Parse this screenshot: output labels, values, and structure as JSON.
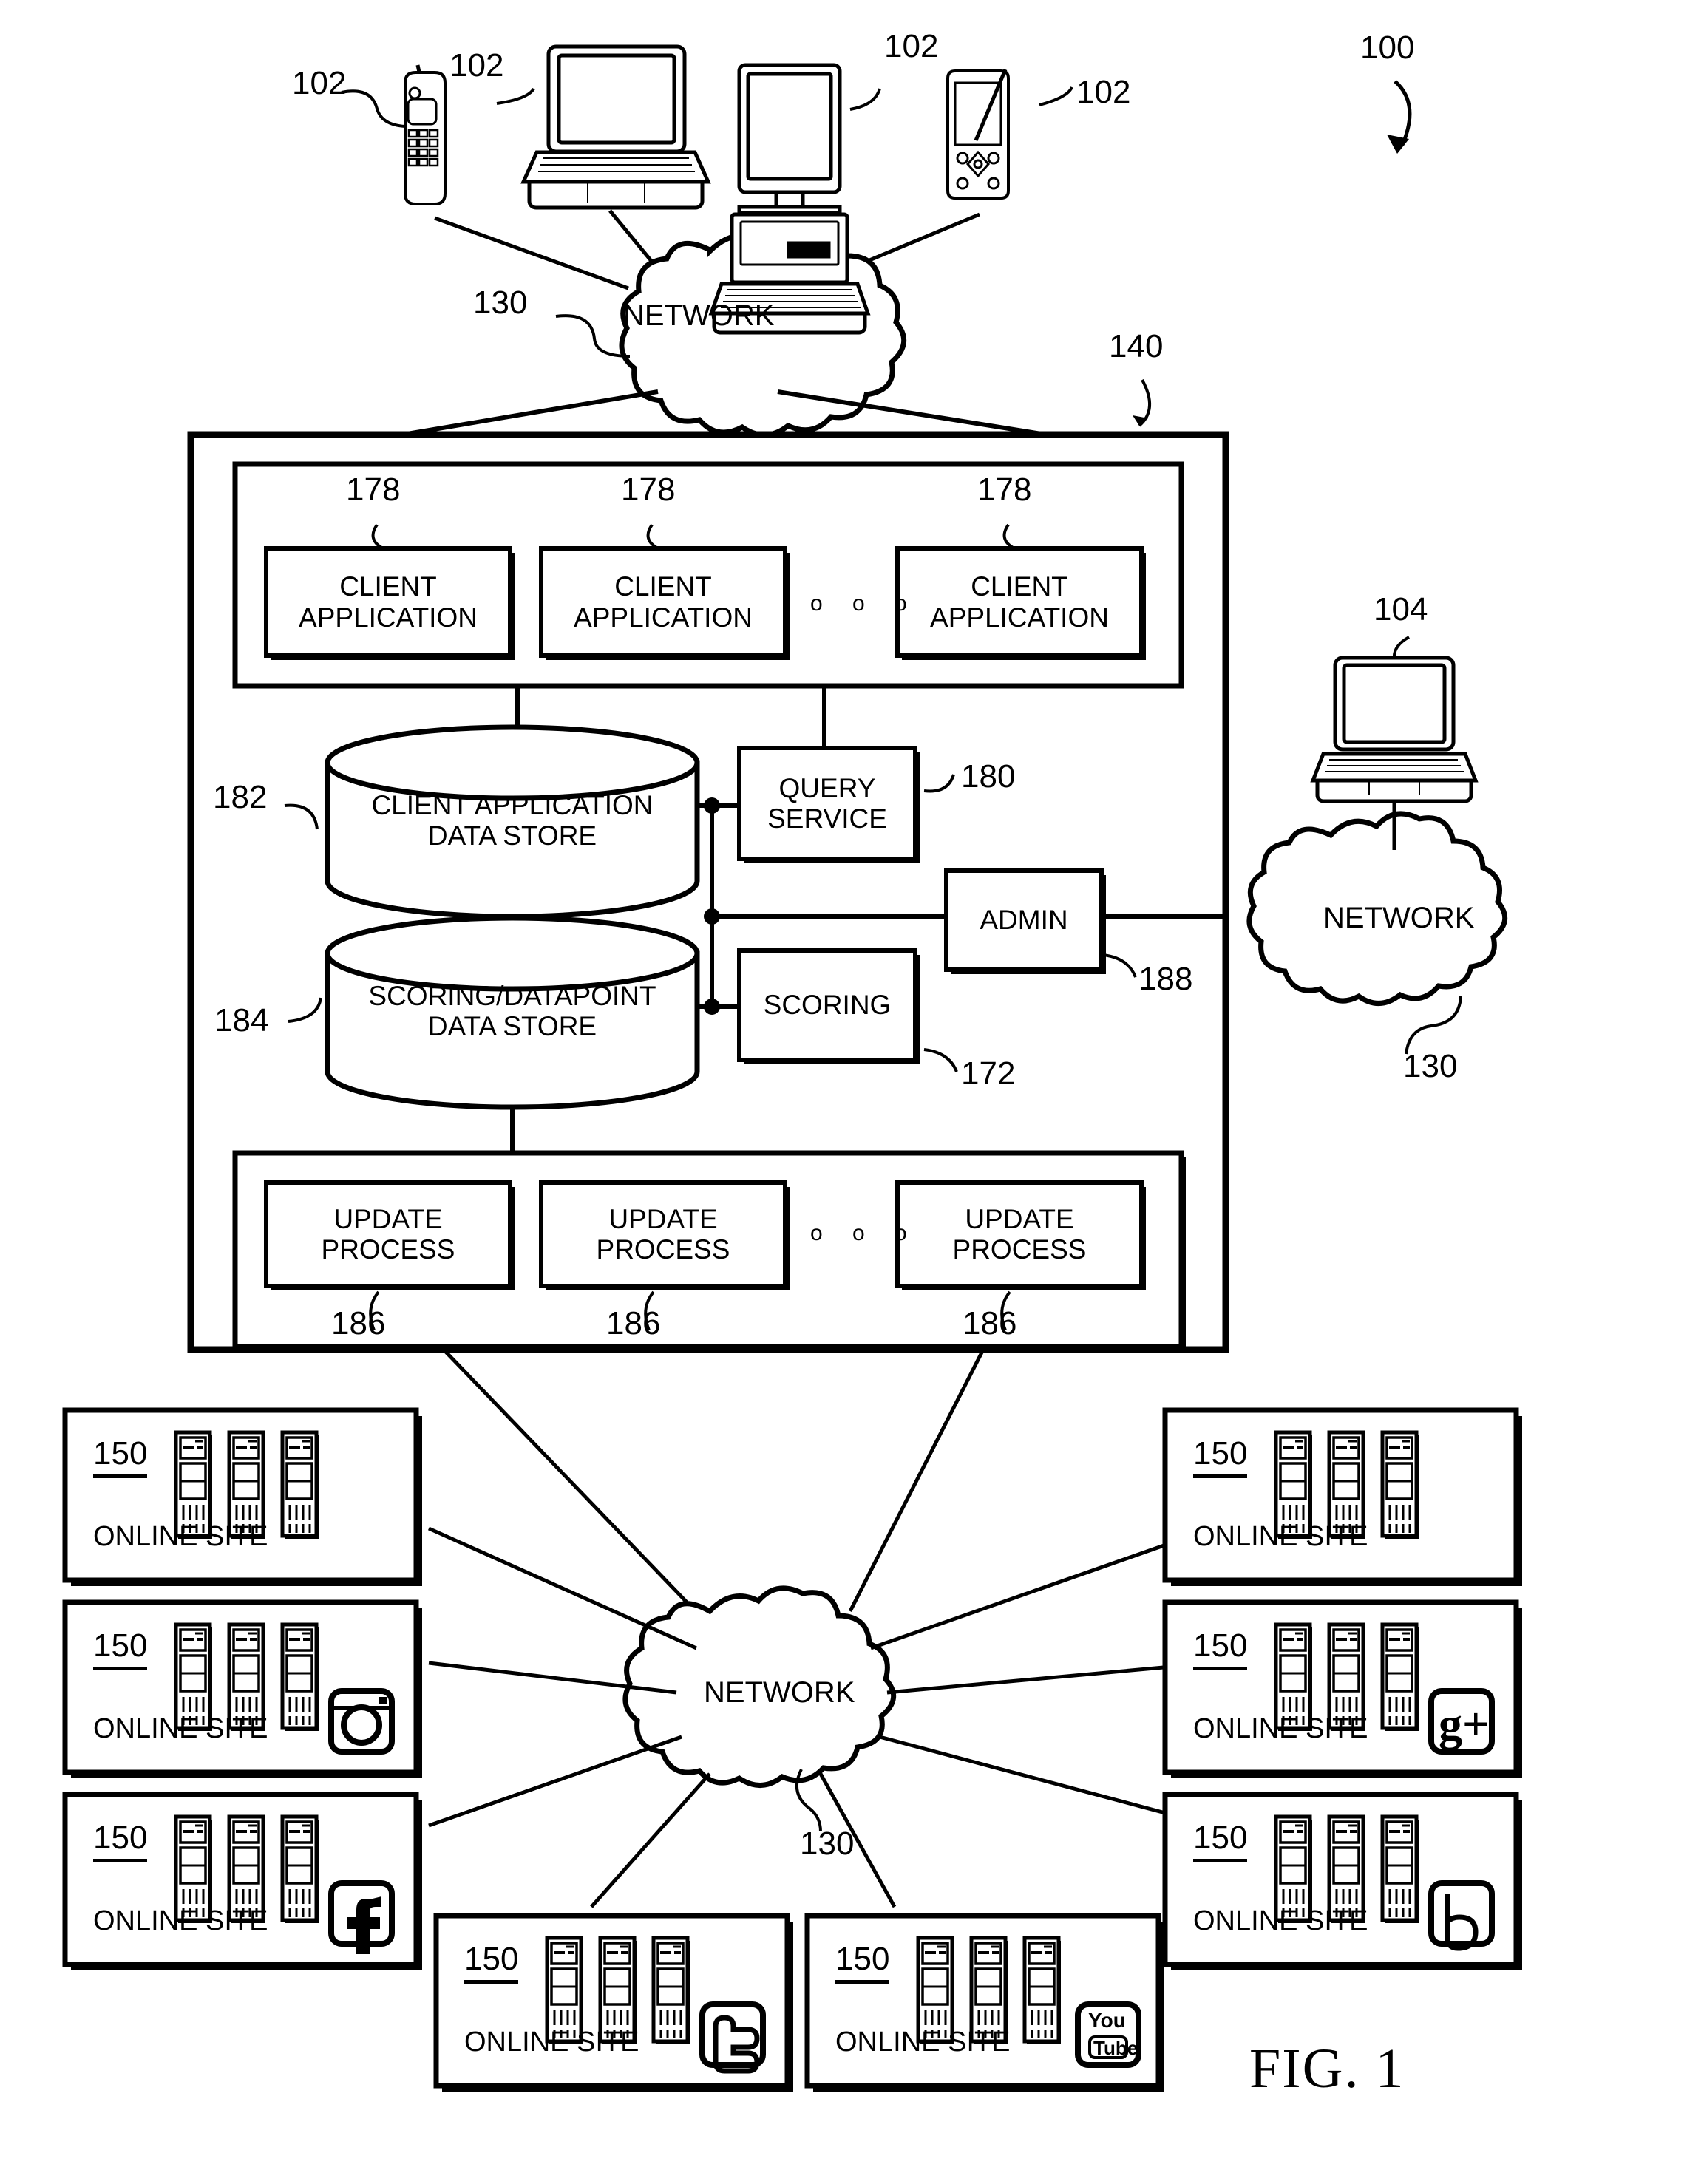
{
  "figure": {
    "label": "FIG. 1",
    "system_ref": "100"
  },
  "clients": {
    "refs": [
      "102",
      "102",
      "102",
      "102"
    ],
    "devices": [
      "mobile-phone",
      "laptop-computer",
      "desktop-computer",
      "pda-device"
    ]
  },
  "networks": {
    "top": {
      "label": "NETWORK",
      "ref": "130"
    },
    "right": {
      "label": "NETWORK",
      "ref": "130"
    },
    "bottom": {
      "label": "NETWORK",
      "ref": "130"
    }
  },
  "server_system": {
    "ref": "140",
    "client_app_group": {
      "refs": [
        "178",
        "178",
        "178"
      ],
      "boxes": [
        {
          "line1": "CLIENT",
          "line2": "APPLICATION"
        },
        {
          "line1": "CLIENT",
          "line2": "APPLICATION"
        },
        {
          "line1": "CLIENT",
          "line2": "APPLICATION"
        }
      ],
      "ellipsis": "o o o"
    },
    "data_stores": [
      {
        "ref": "182",
        "line1": "CLIENT APPLICATION",
        "line2": "DATA STORE"
      },
      {
        "ref": "184",
        "line1": "SCORING/DATAPOINT",
        "line2": "DATA STORE"
      }
    ],
    "services": [
      {
        "ref": "180",
        "line1": "QUERY",
        "line2": "SERVICE"
      },
      {
        "ref": "188",
        "line1": "ADMIN",
        "line2": ""
      },
      {
        "ref": "172",
        "line1": "SCORING",
        "line2": ""
      }
    ],
    "update_group": {
      "refs": [
        "186",
        "186",
        "186"
      ],
      "boxes": [
        {
          "line1": "UPDATE",
          "line2": "PROCESS"
        },
        {
          "line1": "UPDATE",
          "line2": "PROCESS"
        },
        {
          "line1": "UPDATE",
          "line2": "PROCESS"
        }
      ],
      "ellipsis": "o o o"
    }
  },
  "admin_terminal": {
    "ref": "104",
    "device": "laptop-computer"
  },
  "online_sites": [
    {
      "ref": "150",
      "label": "ONLINE SITE",
      "icon": "none",
      "position": "left-top"
    },
    {
      "ref": "150",
      "label": "ONLINE SITE",
      "icon": "instagram",
      "position": "left-middle"
    },
    {
      "ref": "150",
      "label": "ONLINE SITE",
      "icon": "facebook",
      "position": "left-bottom"
    },
    {
      "ref": "150",
      "label": "ONLINE SITE",
      "icon": "twitter",
      "position": "bottom-center-left"
    },
    {
      "ref": "150",
      "label": "ONLINE SITE",
      "icon": "youtube",
      "position": "bottom-center-right"
    },
    {
      "ref": "150",
      "label": "ONLINE SITE",
      "icon": "none",
      "position": "right-top"
    },
    {
      "ref": "150",
      "label": "ONLINE SITE",
      "icon": "googleplus",
      "position": "right-middle"
    },
    {
      "ref": "150",
      "label": "ONLINE SITE",
      "icon": "bing",
      "position": "right-bottom"
    }
  ],
  "icon_text": {
    "googleplus": "g+",
    "youtube_top": "You",
    "youtube_bottom": "Tube"
  },
  "colors": {
    "stroke": "#000000",
    "background": "#ffffff"
  }
}
